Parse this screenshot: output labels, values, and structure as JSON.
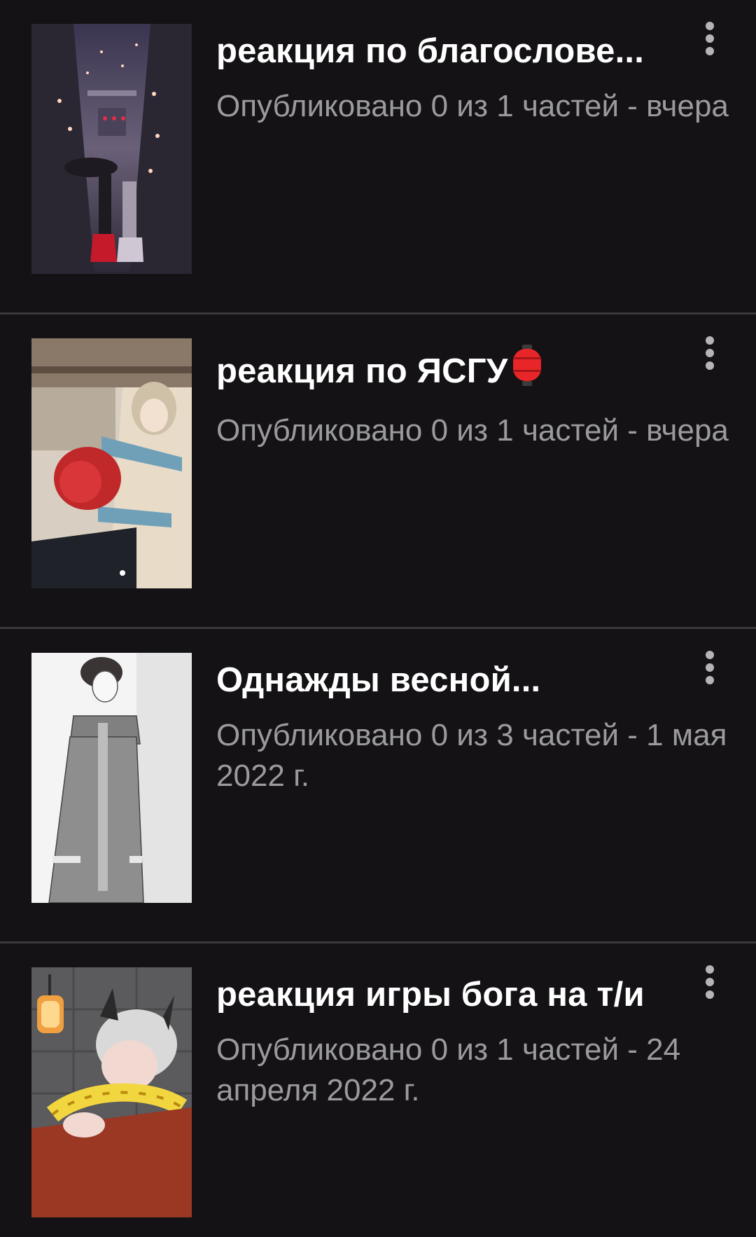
{
  "stories": [
    {
      "title": "реакция по благослове...",
      "meta": "Опубликовано 0 из 1 частей - вчера",
      "cover_icon": "lantern-street-illustration",
      "has_emoji": false
    },
    {
      "title": "реакция по ЯСГУ",
      "meta": "Опубликовано 0 из 1 частей - вчера",
      "cover_icon": "manhwa-characters-illustration",
      "has_emoji": true,
      "emoji_icon": "red-lantern-emoji"
    },
    {
      "title": "Однажды весной...",
      "meta": "Опубликовано 0 из 3 частей - 1 мая 2022 г.",
      "cover_icon": "sketch-figure-illustration",
      "has_emoji": false
    },
    {
      "title": "реакция игры бога на т/и",
      "meta": "Опубликовано 0 из 1 частей - 24 апреля 2022 г.",
      "cover_icon": "horned-character-illustration",
      "has_emoji": false
    }
  ],
  "colors": {
    "background": "#141215",
    "divider": "#3a383c",
    "title": "#ffffff",
    "meta": "#9b9a9e",
    "menu_dots": "#b6b4b8"
  },
  "menu_icon": "more-vertical-icon"
}
